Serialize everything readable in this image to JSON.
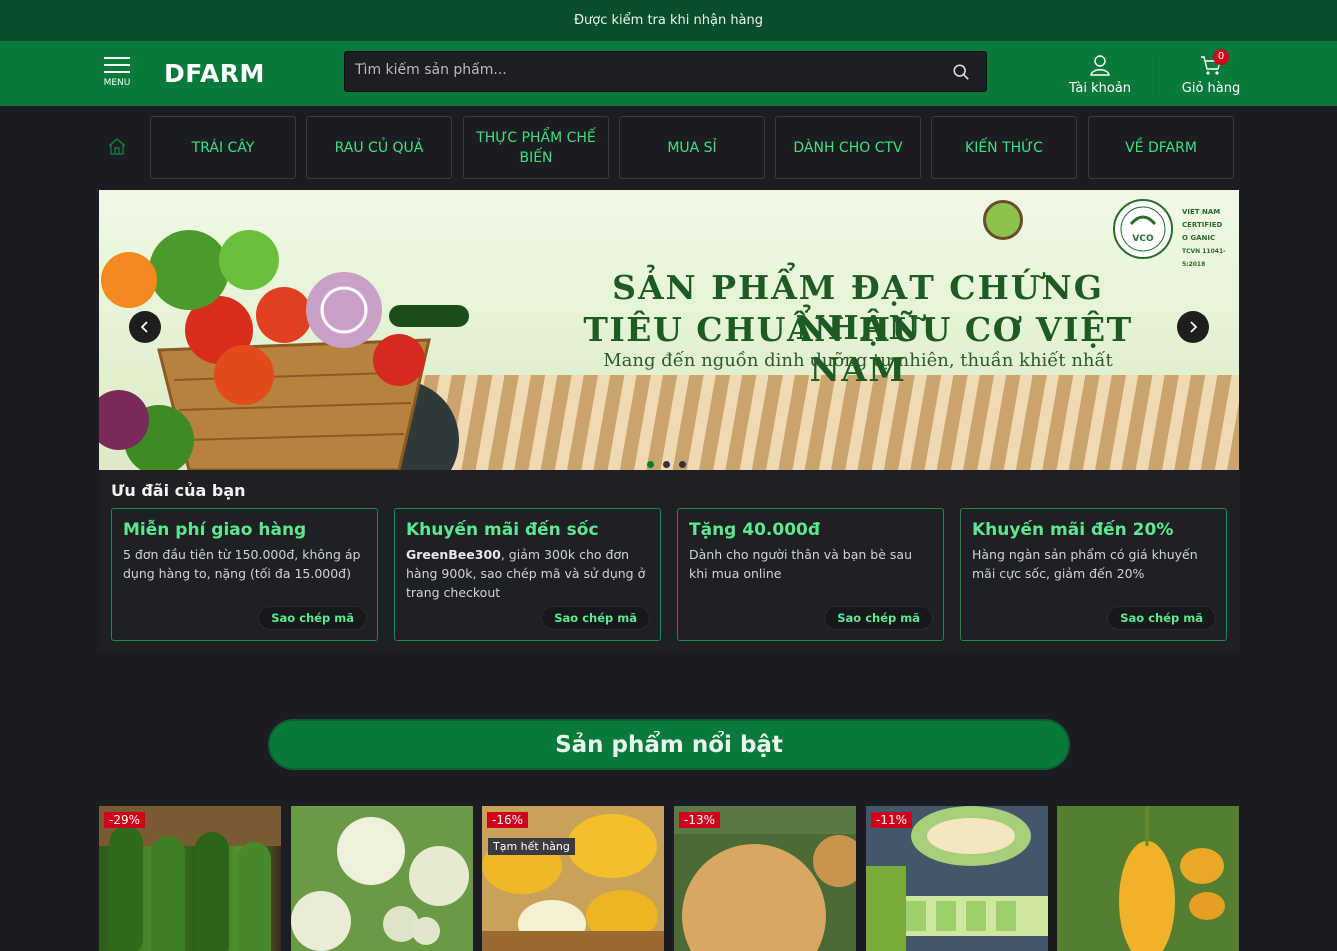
{
  "topbar": {
    "text": "Được kiểm tra khi nhận hàng"
  },
  "header": {
    "menu_label": "MENU",
    "logo": "DFARM",
    "search_placeholder": "Tìm kiếm sản phẩm...",
    "account_label": "Tài khoản",
    "cart_label": "Giỏ hàng",
    "cart_count": "0"
  },
  "nav": {
    "items": [
      {
        "label": "TRÁI CÂY"
      },
      {
        "label": "RAU CỦ QUẢ"
      },
      {
        "label": "THỰC PHẨM CHẾ BIẾN"
      },
      {
        "label": "MUA SỈ"
      },
      {
        "label": "DÀNH CHO CTV"
      },
      {
        "label": "KIẾN THỨC"
      },
      {
        "label": "VỀ DFARM"
      }
    ]
  },
  "banner": {
    "line1": "SẢN PHẨM ĐẠT CHỨNG NHẬN",
    "line2": "TIÊU CHUẨN HỮU CƠ VIỆT NAM",
    "line3": "Mang đến nguồn dinh dưỡng tự nhiên, thuần khiết nhất",
    "cert_lines": [
      "VIET NAM",
      "CERTIFIED",
      "O  GANIC",
      "TCVN 11041-5:2018"
    ],
    "cert_badge": "VCO",
    "active_slide": 1,
    "slide_count": 3
  },
  "offers": {
    "title": "Ưu đãi của bạn",
    "cards": [
      {
        "title": "Miễn phí giao hàng",
        "code": "",
        "desc": "5 đơn đầu tiên từ 150.000đ, không áp dụng hàng to, nặng (tối đa 15.000đ)",
        "button": "Sao chép mã"
      },
      {
        "title": "Khuyến mãi đến sốc",
        "code": "GreenBee300",
        "desc": ", giảm 300k cho đơn hàng 900k, sao chép mã và sử dụng ở trang checkout",
        "button": "Sao chép mã"
      },
      {
        "title": "Tặng 40.000đ",
        "code": "",
        "desc": "Dành cho người thân và bạn bè sau khi mua online",
        "button": "Sao chép mã"
      },
      {
        "title": "Khuyến mãi đến 20%",
        "code": "",
        "desc": "Hàng ngàn sản phẩm có giá khuyến mãi cực sốc, giảm đến 20%",
        "button": "Sao chép mã"
      }
    ]
  },
  "featured": {
    "title": "Sản phẩm nổi bật"
  },
  "products": [
    {
      "discount": "-29%",
      "status": ""
    },
    {
      "discount": "",
      "status": ""
    },
    {
      "discount": "-16%",
      "status": "Tạm hết hàng"
    },
    {
      "discount": "-13%",
      "status": ""
    },
    {
      "discount": "-11%",
      "status": ""
    },
    {
      "discount": "",
      "status": ""
    }
  ],
  "colors": {
    "brand": "#0a7a3c",
    "brand_dark": "#0a4f2a",
    "accent": "#5de88f",
    "badge": "#d0021b"
  }
}
